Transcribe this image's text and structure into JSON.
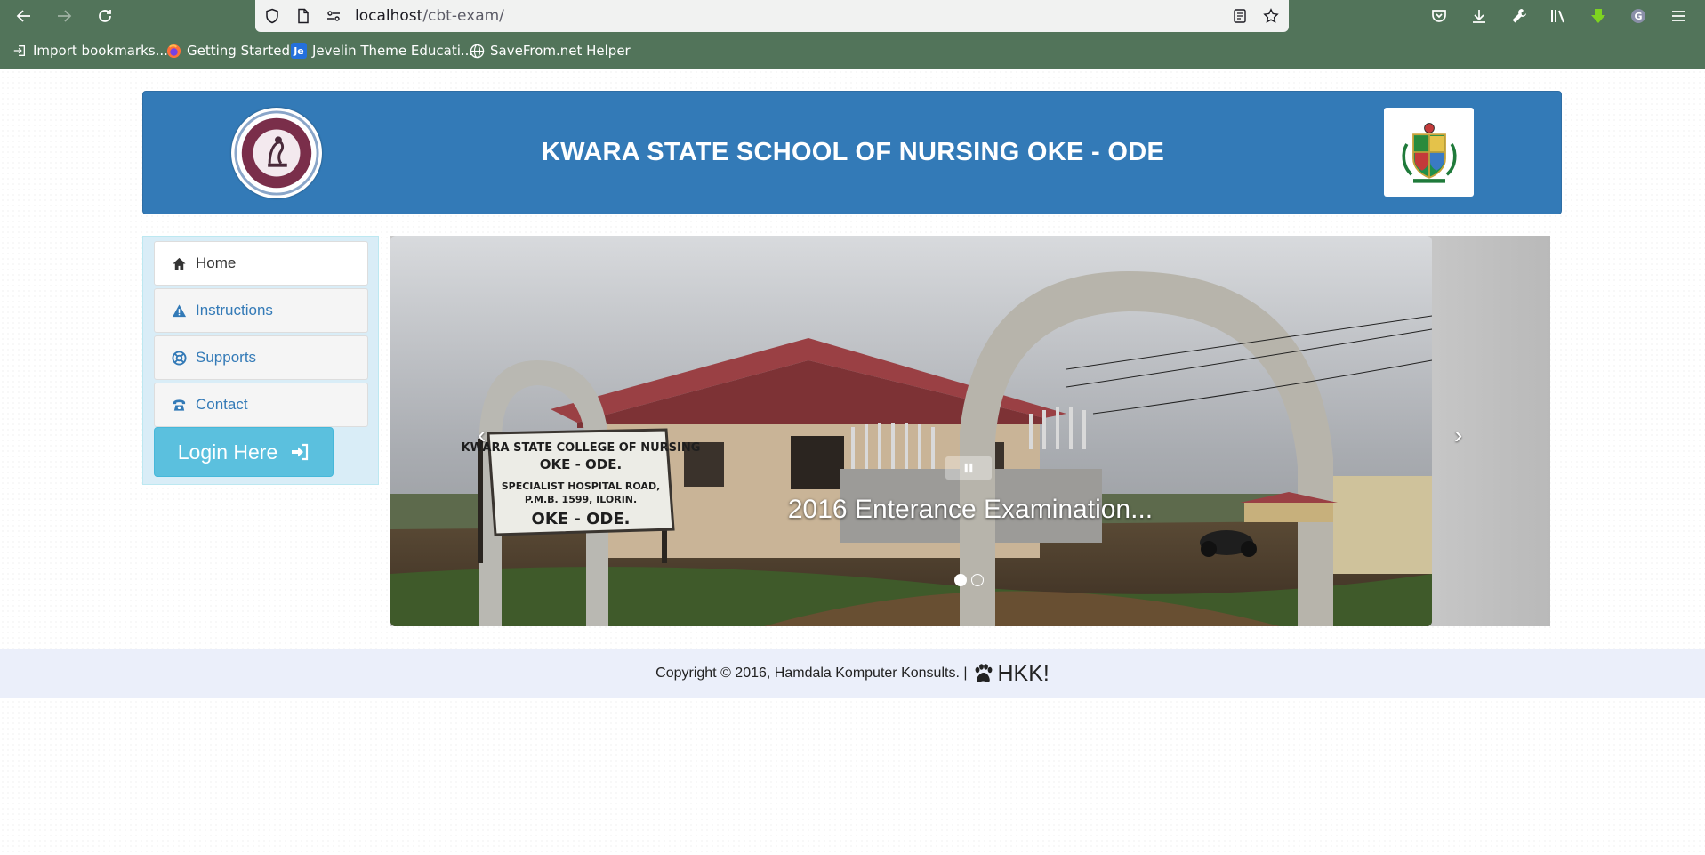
{
  "browser": {
    "url_host": "localhost",
    "url_path": "/cbt-exam/",
    "bookmarks": [
      {
        "label": "Import bookmarks...",
        "icon": "import-icon"
      },
      {
        "label": "Getting Started",
        "icon": "firefox-icon"
      },
      {
        "label": "Jevelin Theme Educati...",
        "icon": "jevelin-icon",
        "icon_text": "Je"
      },
      {
        "label": "SaveFrom.net Helper",
        "icon": "globe-icon"
      }
    ]
  },
  "header": {
    "title": "KWARA STATE SCHOOL OF NURSING OKE - ODE",
    "left_logo": "college-of-nursing-seal",
    "right_logo": "kwara-state-coat-of-arms"
  },
  "sidebar": {
    "items": [
      {
        "label": "Home",
        "icon": "home-icon"
      },
      {
        "label": "Instructions",
        "icon": "warning-icon"
      },
      {
        "label": "Supports",
        "icon": "lifebuoy-icon"
      },
      {
        "label": "Contact",
        "icon": "phone-icon"
      }
    ],
    "login_label": "Login Here"
  },
  "carousel": {
    "caption": "2016 Enterance Examination...",
    "slide_count": 2,
    "active_slide": 1,
    "sign_lines": [
      "KWARA STATE COLLEGE OF NURSING",
      "OKE - ODE.",
      "SPECIALIST HOSPITAL ROAD,",
      "P.M.B. 1599, ILORIN.",
      "OKE - ODE."
    ]
  },
  "footer": {
    "copyright": "Copyright © 2016, Hamdala Komputer Konsults. |",
    "brand": "HKK!"
  },
  "colors": {
    "browser_chrome": "#52745a",
    "header_bg": "#337ab7",
    "sidebar_bg": "#d9edf7",
    "login_bg": "#5bc0de",
    "footer_bg": "#ebeffa"
  }
}
